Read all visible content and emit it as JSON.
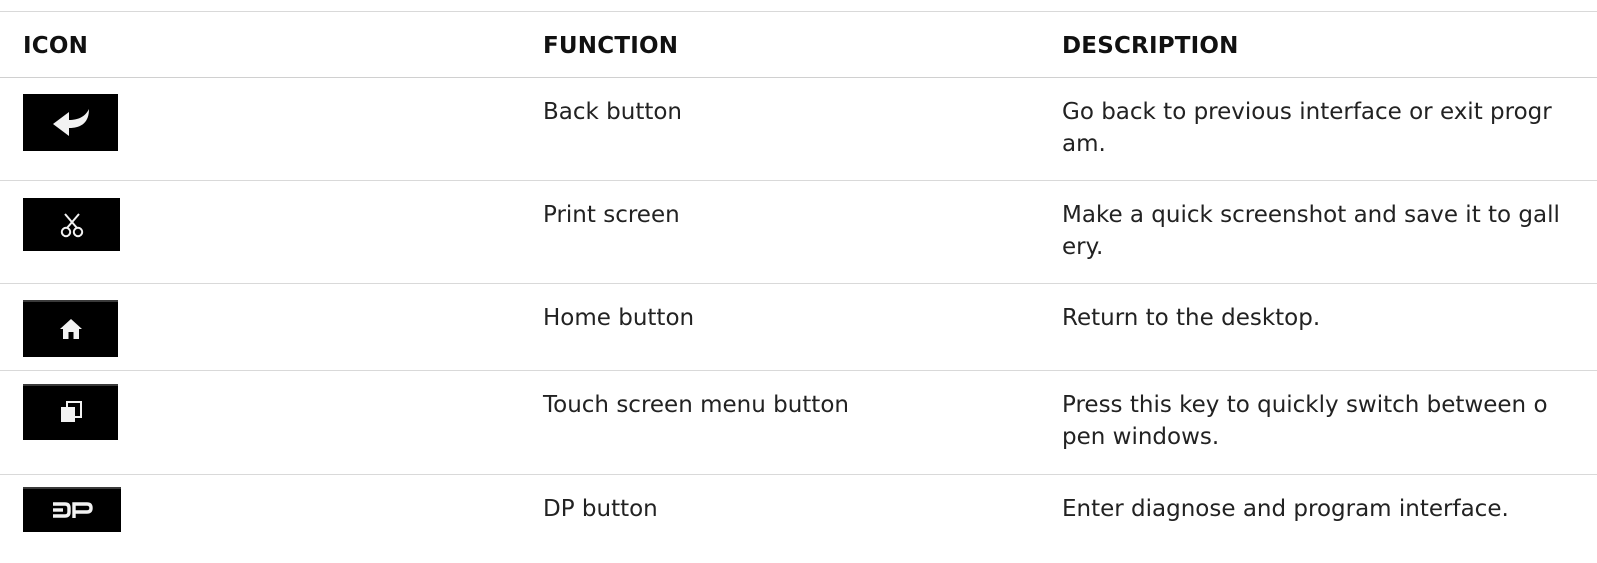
{
  "headers": {
    "icon": "ICON",
    "function": "FUNCTION",
    "description": "DESCRIPTION"
  },
  "rows": [
    {
      "icon": "back-arrow-icon",
      "function": "Back button",
      "description": "Go back to previous interface or exit program."
    },
    {
      "icon": "scissors-icon",
      "function": "Print screen",
      "description": "Make a quick screenshot and save it to gallery."
    },
    {
      "icon": "home-icon",
      "function": "Home button",
      "description": "Return to the desktop."
    },
    {
      "icon": "windows-stack-icon",
      "function": "Touch screen menu button",
      "description": "Press this key to quickly switch between open windows."
    },
    {
      "icon": "dp-icon",
      "function": "DP button",
      "description": "Enter diagnose and program interface."
    }
  ],
  "colors": {
    "icon_background": "#000000",
    "icon_glyph": "#f2f2f2",
    "divider": "#d9d9d9",
    "text": "#222222"
  }
}
